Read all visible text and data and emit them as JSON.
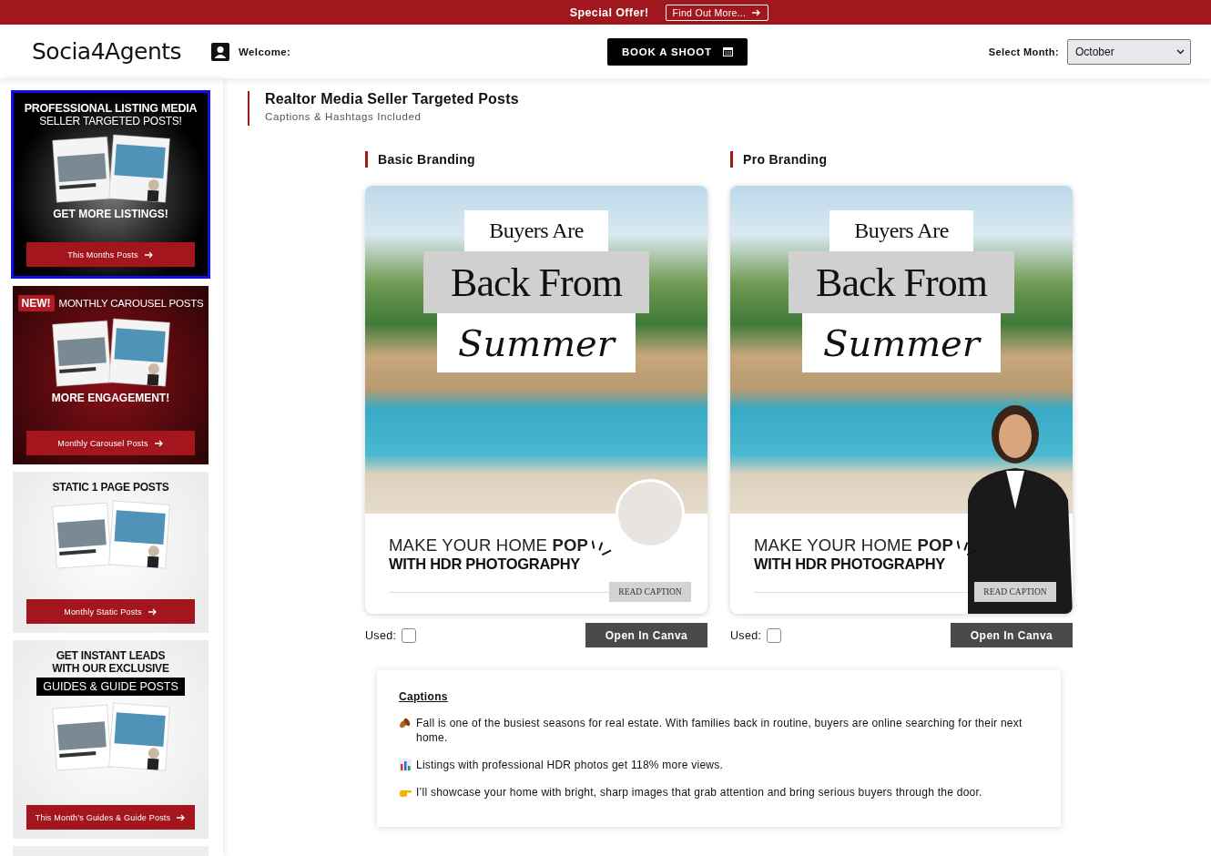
{
  "promo_bar": {
    "text": "Special Offer!",
    "link": "Find Out More..."
  },
  "header": {
    "logo": "Socia4Agents",
    "welcome": "Welcome:",
    "book_button": "BOOK A SHOOT",
    "month_label": "Select Month:",
    "month_select": {
      "value": "October"
    }
  },
  "sidebar": {
    "banners": [
      {
        "kind": "dark",
        "selected": true,
        "headline": "PROFESSIONAL LISTING MEDIA",
        "subline": "SELLER TARGETED POSTS!",
        "tagline": "GET MORE LISTINGS!",
        "button": "This Months Posts"
      },
      {
        "kind": "maroon",
        "selected": false,
        "badge": "NEW!",
        "headline": "MONTHLY CAROUSEL POSTS",
        "tagline": "MORE ENGAGEMENT!",
        "button": "Monthly Carousel Posts"
      },
      {
        "kind": "light",
        "selected": false,
        "headline": "STATIC 1 PAGE POSTS",
        "button": "Monthly Static Posts"
      },
      {
        "kind": "light",
        "selected": false,
        "headline": "GET INSTANT LEADS WITH OUR EXCLUSIVE",
        "highlight": "GUIDES & GUIDE POSTS",
        "button": "This Month’s Guides & Guide Posts"
      }
    ]
  },
  "main": {
    "title": "Realtor Media Seller Targeted Posts",
    "subtitle": "Captions & Hashtags Included",
    "columns": [
      {
        "heading": "Basic Branding",
        "kind": "basic",
        "post": {
          "line1": "Buyers Are",
          "line2": "Back From",
          "line3": "Summer",
          "tagline": "MAKE YOUR HOME **POP**",
          "tagline2": "WITH HDR PHOTOGRAPHY",
          "read_caption": "READ CAPTION"
        },
        "used_label": "Used:",
        "used_checked": false,
        "button": "Open In Canva"
      },
      {
        "heading": "Pro Branding",
        "kind": "pro",
        "post": {
          "line1": "Buyers Are",
          "line2": "Back From",
          "line3": "Summer",
          "tagline": "MAKE YOUR HOME **POP**",
          "tagline2": "WITH HDR PHOTOGRAPHY",
          "read_caption": "READ CAPTION"
        },
        "used_label": "Used:",
        "used_checked": false,
        "button": "Open In Canva"
      }
    ],
    "captions": {
      "heading": "Captions",
      "items": [
        {
          "kind": "leaves",
          "text": "Fall is one of the busiest seasons for real estate. With families back in routine, buyers are online searching for their next home."
        },
        {
          "kind": "chart",
          "text": "Listings with professional HDR photos get 118% more views."
        },
        {
          "kind": "pointer",
          "text": "I’ll showcase your home with bright, sharp images that grab attention and bring serious buyers through the door."
        }
      ]
    }
  }
}
